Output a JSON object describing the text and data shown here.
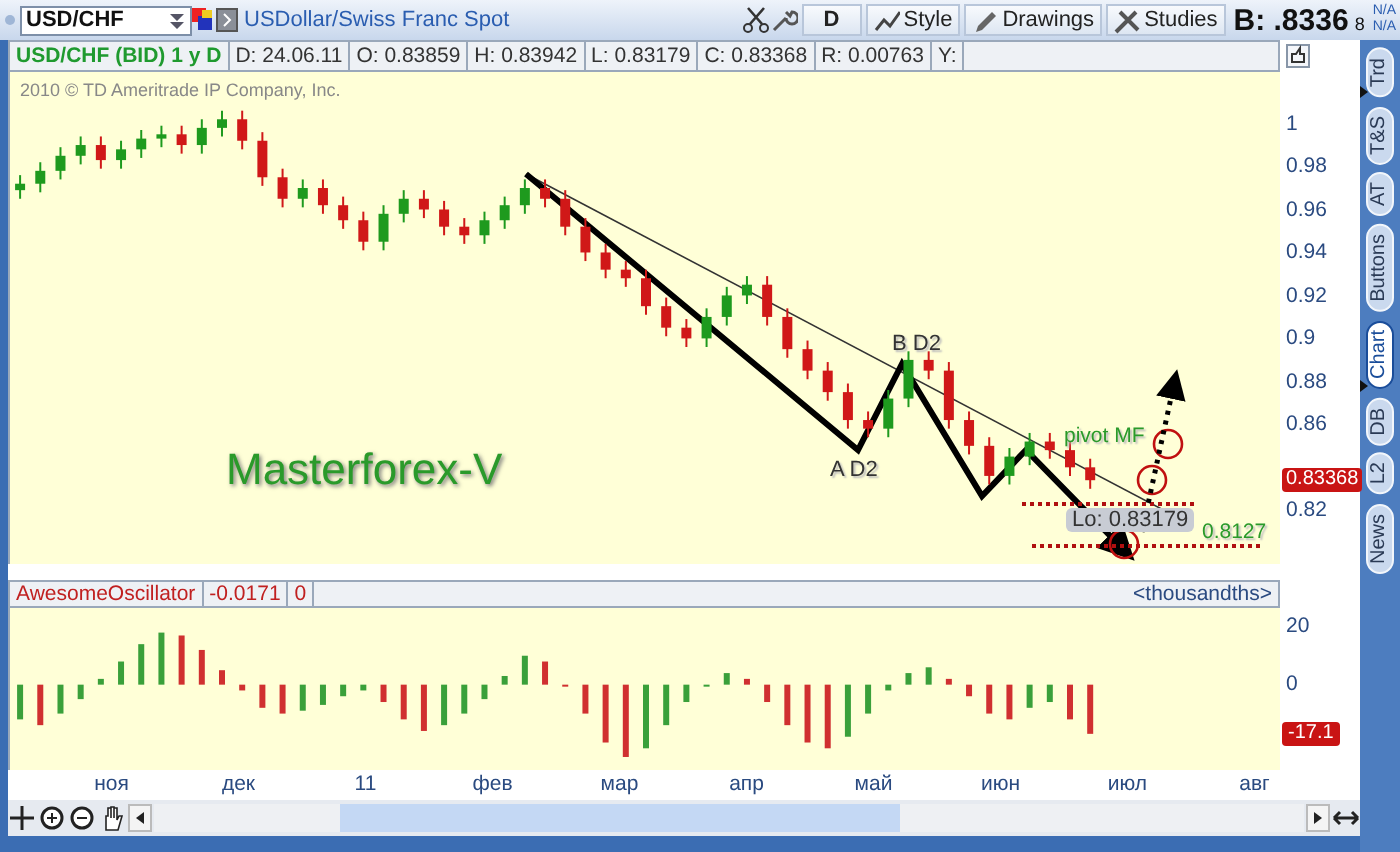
{
  "toolbar": {
    "symbol": "USD/CHF",
    "description": "USDollar/Swiss Franc Spot",
    "buttons": [
      {
        "label": "D",
        "kind": "period"
      },
      {
        "label": "Style",
        "kind": "style"
      },
      {
        "label": "Drawings",
        "kind": "drawings"
      },
      {
        "label": "Studies",
        "kind": "studies"
      }
    ],
    "bid": {
      "label": "B:",
      "value": ".8336",
      "fraction": "8"
    },
    "quote_status": [
      "N/A",
      "N/A"
    ]
  },
  "info_bar": {
    "title": "USD/CHF (BID) 1 y D",
    "fields": [
      "D: 24.06.11",
      "O: 0.83859",
      "H: 0.83942",
      "L: 0.83179",
      "C: 0.83368",
      "R: 0.00763",
      "Y:"
    ]
  },
  "price_chart": {
    "copyright": "2010 © TD Ameritrade IP Company, Inc.",
    "last_price": "0.83368",
    "annotations": [
      {
        "text": "Masterforex-V",
        "kind": "title"
      },
      {
        "text": "A D2",
        "kind": "point"
      },
      {
        "text": "B D2",
        "kind": "point"
      },
      {
        "text": "pivot MF",
        "kind": "level"
      },
      {
        "text": "Lo: 0.83179",
        "kind": "low"
      },
      {
        "text": "0.8127",
        "kind": "level"
      }
    ],
    "chart_data": {
      "type": "candlestick",
      "ylim": [
        0.795,
        1.024
      ],
      "categories": [
        null,
        null,
        null,
        null,
        null,
        null,
        null,
        null,
        null,
        null,
        null,
        null,
        null,
        null,
        null,
        null,
        null,
        null,
        null,
        null,
        null,
        null,
        null,
        null,
        null,
        null,
        null,
        null,
        null,
        null,
        null,
        null,
        null,
        null,
        null,
        null,
        null,
        null,
        null,
        null,
        null,
        null,
        null,
        null,
        null,
        null,
        null,
        null,
        null,
        null,
        null,
        null,
        null,
        null,
        null,
        null,
        null,
        null,
        null,
        null,
        null,
        null,
        null
      ],
      "yticks": [
        {
          "value": 1,
          "label": "1"
        },
        {
          "value": 0.98,
          "label": "0.98"
        },
        {
          "value": 0.96,
          "label": "0.96"
        },
        {
          "value": 0.94,
          "label": "0.94"
        },
        {
          "value": 0.92,
          "label": "0.92"
        },
        {
          "value": 0.9,
          "label": "0.9"
        },
        {
          "value": 0.88,
          "label": "0.88"
        },
        {
          "value": 0.86,
          "label": "0.86"
        },
        {
          "value": 0.82,
          "label": "0.82"
        }
      ],
      "ohlc": [
        [
          0.969,
          0.976,
          0.965,
          0.972
        ],
        [
          0.972,
          0.982,
          0.968,
          0.978
        ],
        [
          0.978,
          0.989,
          0.974,
          0.985
        ],
        [
          0.985,
          0.994,
          0.981,
          0.99
        ],
        [
          0.99,
          0.994,
          0.979,
          0.983
        ],
        [
          0.983,
          0.992,
          0.979,
          0.988
        ],
        [
          0.988,
          0.997,
          0.984,
          0.993
        ],
        [
          0.993,
          0.999,
          0.989,
          0.995
        ],
        [
          0.995,
          0.999,
          0.986,
          0.99
        ],
        [
          0.99,
          1.002,
          0.986,
          0.998
        ],
        [
          0.998,
          1.006,
          0.994,
          1.002
        ],
        [
          1.002,
          1.006,
          0.988,
          0.992
        ],
        [
          0.992,
          0.996,
          0.971,
          0.975
        ],
        [
          0.975,
          0.979,
          0.961,
          0.965
        ],
        [
          0.965,
          0.974,
          0.961,
          0.97
        ],
        [
          0.97,
          0.974,
          0.958,
          0.962
        ],
        [
          0.962,
          0.966,
          0.951,
          0.955
        ],
        [
          0.955,
          0.959,
          0.941,
          0.945
        ],
        [
          0.945,
          0.962,
          0.941,
          0.958
        ],
        [
          0.958,
          0.969,
          0.954,
          0.965
        ],
        [
          0.965,
          0.969,
          0.956,
          0.96
        ],
        [
          0.96,
          0.964,
          0.948,
          0.952
        ],
        [
          0.952,
          0.956,
          0.944,
          0.948
        ],
        [
          0.948,
          0.959,
          0.944,
          0.955
        ],
        [
          0.955,
          0.966,
          0.951,
          0.962
        ],
        [
          0.962,
          0.974,
          0.958,
          0.97
        ],
        [
          0.97,
          0.974,
          0.961,
          0.965
        ],
        [
          0.965,
          0.969,
          0.948,
          0.952
        ],
        [
          0.952,
          0.956,
          0.936,
          0.94
        ],
        [
          0.94,
          0.944,
          0.928,
          0.932
        ],
        [
          0.932,
          0.936,
          0.924,
          0.928
        ],
        [
          0.928,
          0.932,
          0.911,
          0.915
        ],
        [
          0.915,
          0.919,
          0.901,
          0.905
        ],
        [
          0.905,
          0.909,
          0.896,
          0.9
        ],
        [
          0.9,
          0.914,
          0.896,
          0.91
        ],
        [
          0.91,
          0.924,
          0.906,
          0.92
        ],
        [
          0.92,
          0.929,
          0.916,
          0.925
        ],
        [
          0.925,
          0.929,
          0.906,
          0.91
        ],
        [
          0.91,
          0.914,
          0.891,
          0.895
        ],
        [
          0.895,
          0.899,
          0.881,
          0.885
        ],
        [
          0.885,
          0.889,
          0.871,
          0.875
        ],
        [
          0.875,
          0.879,
          0.858,
          0.862
        ],
        [
          0.862,
          0.866,
          0.854,
          0.858
        ],
        [
          0.858,
          0.876,
          0.854,
          0.872
        ],
        [
          0.872,
          0.894,
          0.868,
          0.89
        ],
        [
          0.89,
          0.894,
          0.881,
          0.885
        ],
        [
          0.885,
          0.889,
          0.858,
          0.862
        ],
        [
          0.862,
          0.866,
          0.846,
          0.85
        ],
        [
          0.85,
          0.854,
          0.832,
          0.836
        ],
        [
          0.836,
          0.849,
          0.832,
          0.845
        ],
        [
          0.845,
          0.856,
          0.841,
          0.852
        ],
        [
          0.852,
          0.856,
          0.844,
          0.848
        ],
        [
          0.848,
          0.852,
          0.836,
          0.84
        ],
        [
          0.84,
          0.844,
          0.83,
          0.834
        ],
        null,
        null,
        null,
        null,
        null,
        null,
        null,
        null,
        null
      ]
    }
  },
  "oscillator": {
    "name": "AwesomeOscillator",
    "value": "-0.0171",
    "field_2": "0",
    "units": "<thousandths>",
    "last_value": "-17.1",
    "chart_data": {
      "type": "bar",
      "ylim": [
        -29.5,
        26.5
      ],
      "categories": [
        null,
        null,
        null,
        null,
        null,
        null,
        null,
        null,
        null,
        null,
        null,
        null,
        null,
        null,
        null,
        null,
        null,
        null,
        null,
        null,
        null,
        null,
        null,
        null,
        null,
        null,
        null,
        null,
        null,
        null,
        null,
        null,
        null,
        null,
        null,
        null,
        null,
        null,
        null,
        null,
        null,
        null,
        null,
        null,
        null,
        null,
        null,
        null,
        null,
        null,
        null,
        null,
        null,
        null,
        null,
        null,
        null,
        null,
        null,
        null,
        null,
        null,
        null
      ],
      "yticks": [
        {
          "value": 20,
          "label": "20"
        },
        {
          "value": 0,
          "label": "0"
        }
      ],
      "values": [
        -12,
        -14,
        -10,
        -5,
        2,
        8,
        14,
        18,
        17,
        12,
        5,
        -2,
        -8,
        -10,
        -9,
        -7,
        -4,
        -2,
        -6,
        -12,
        -16,
        -14,
        -10,
        -5,
        3,
        10,
        8,
        0,
        -10,
        -20,
        -25,
        -22,
        -14,
        -6,
        0,
        4,
        2,
        -6,
        -14,
        -20,
        -22,
        -18,
        -10,
        -2,
        4,
        6,
        2,
        -4,
        -10,
        -12,
        -8,
        -6,
        -12,
        -17,
        null,
        null,
        null,
        null,
        null,
        null,
        null,
        null,
        null
      ]
    }
  },
  "time_axis": [
    "ноя",
    "дек",
    "11",
    "фев",
    "мар",
    "апр",
    "май",
    "июн",
    "июл",
    "авг"
  ],
  "side_tabs": [
    {
      "label": "Trd",
      "selected": false
    },
    {
      "label": "T&S",
      "selected": false
    },
    {
      "label": "AT",
      "selected": false
    },
    {
      "label": "Buttons",
      "selected": false
    },
    {
      "label": "Chart",
      "selected": true
    },
    {
      "label": "DB",
      "selected": false
    },
    {
      "label": "L2",
      "selected": false
    },
    {
      "label": "News",
      "selected": false
    }
  ]
}
